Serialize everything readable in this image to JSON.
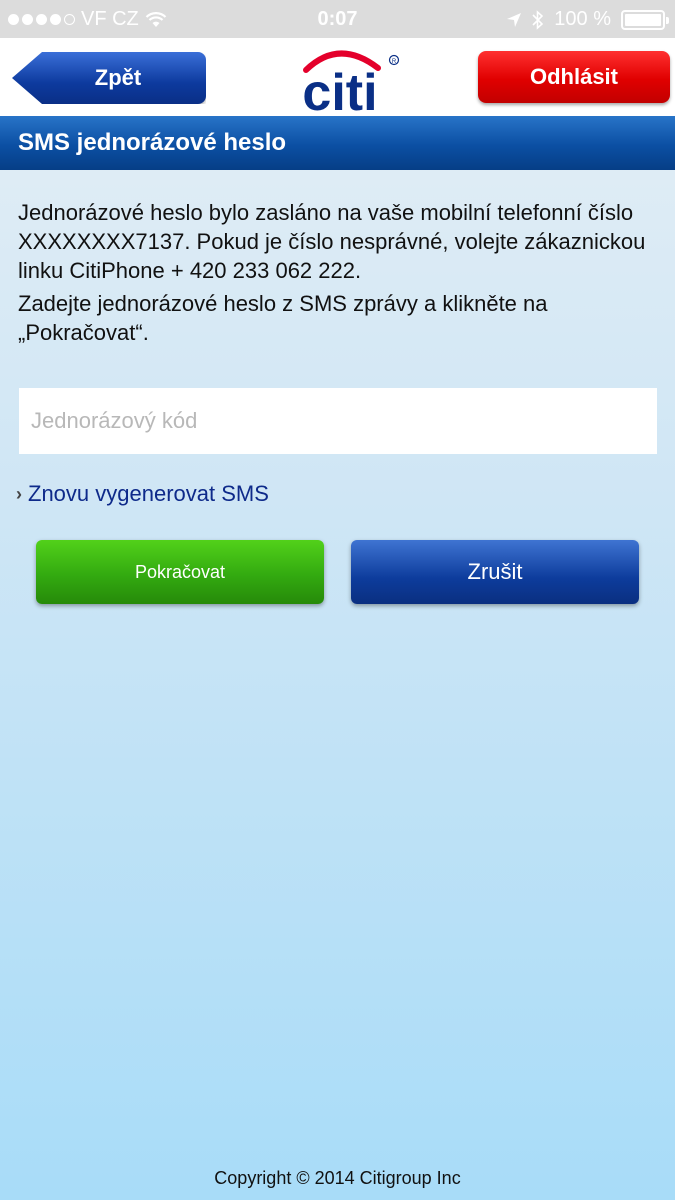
{
  "status_bar": {
    "carrier": "VF CZ",
    "time": "0:07",
    "battery": "100 %",
    "battery_level": 1.0
  },
  "header": {
    "back_label": "Zpět",
    "logo_text": "citi",
    "logout_label": "Odhlásit"
  },
  "page": {
    "title": "SMS jednorázové heslo",
    "info_text": "Jednorázové  heslo bylo zasláno na vaše mobilní telefonní číslo XXXXXXXX7137. Pokud je číslo nesprávné, volejte  zákaznickou linku CitiPhone + 420 233 062 222.",
    "instruction_text": "Zadejte jednorázové heslo z SMS zprávy a klikněte na „Pokračovat“.",
    "code_placeholder": "Jednorázový kód",
    "code_value": "",
    "resend_link": "Znovu vygenerovat SMS",
    "continue_label": "Pokračovat",
    "cancel_label": "Zrušit"
  },
  "footer": {
    "copyright": "Copyright © 2014 Citigroup Inc"
  },
  "colors": {
    "brand_blue": "#0b4fa3",
    "logout_red": "#e00000",
    "continue_green": "#33aa10",
    "link_blue": "#0e2a8a",
    "logo_arc_red": "#e4002b"
  }
}
